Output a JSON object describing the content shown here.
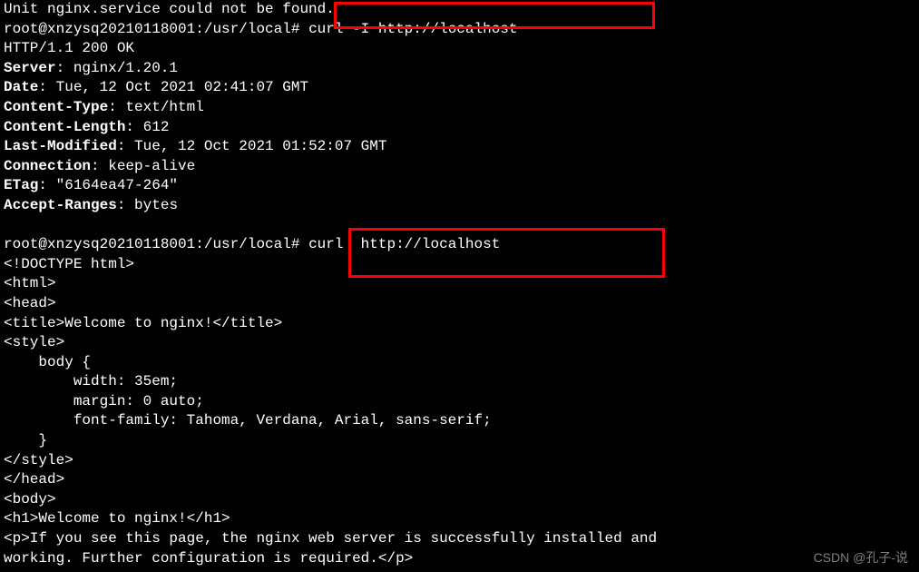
{
  "truncated_line": "Unit nginx.service could not be found.",
  "prompt1_prefix": "root@xnzysq20210118001:/usr/local# ",
  "cmd1": "curl -I http://localhost",
  "response_status": "HTTP/1.1 200 OK",
  "headers": {
    "server_label": "Server",
    "server_value": ": nginx/1.20.1",
    "date_label": "Date",
    "date_value": ": Tue, 12 Oct 2021 02:41:07 GMT",
    "ctype_label": "Content-Type",
    "ctype_value": ": text/html",
    "clen_label": "Content-Length",
    "clen_value": ": 612",
    "lastmod_label": "Last-Modified",
    "lastmod_value": ": Tue, 12 Oct 2021 01:52:07 GMT",
    "conn_label": "Connection",
    "conn_value": ": keep-alive",
    "etag_label": "ETag",
    "etag_value": ": \"6164ea47-264\"",
    "arange_label": "Accept-Ranges",
    "arange_value": ": bytes"
  },
  "blank": " ",
  "prompt2_prefix": "root@xnzysq20210118001:/usr/local# ",
  "cmd2": "curl  http://localhost",
  "html_out": {
    "l1": "<!DOCTYPE html>",
    "l2": "<html>",
    "l3": "<head>",
    "l4": "<title>Welcome to nginx!</title>",
    "l5": "<style>",
    "l6": "    body {",
    "l7": "        width: 35em;",
    "l8": "        margin: 0 auto;",
    "l9": "        font-family: Tahoma, Verdana, Arial, sans-serif;",
    "l10": "    }",
    "l11": "</style>",
    "l12": "</head>",
    "l13": "<body>",
    "l14": "<h1>Welcome to nginx!</h1>",
    "l15": "<p>If you see this page, the nginx web server is successfully installed and",
    "l16": "working. Further configuration is required.</p>"
  },
  "watermark": "CSDN @孔子-说"
}
